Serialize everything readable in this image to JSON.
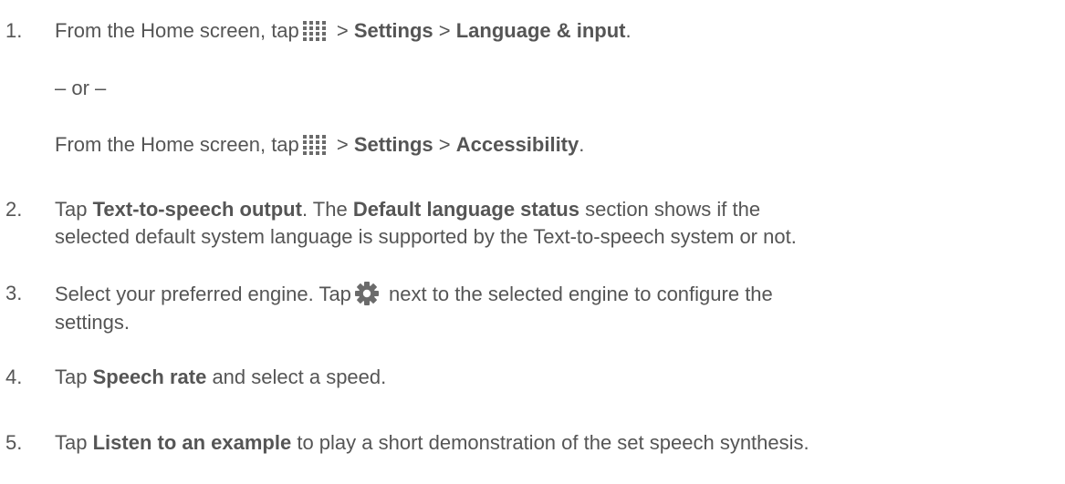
{
  "steps": [
    {
      "number": "1.",
      "line1": {
        "pre": "From the Home screen, tap",
        "sep1": " > ",
        "b1": "Settings",
        "sep2": " > ",
        "b2": "Language & input",
        "end": "."
      },
      "or": "– or –",
      "line2": {
        "pre": "From the Home screen, tap",
        "sep1": " > ",
        "b1": "Settings",
        "sep2": " > ",
        "b2": "Accessibility",
        "end": "."
      }
    },
    {
      "number": "2.",
      "pre": "Tap ",
      "b1": "Text-to-speech output",
      "mid": ". The ",
      "b2": "Default language status",
      "post": " section shows if the",
      "line2": "selected default system language is supported by the Text-to-speech system or not."
    },
    {
      "number": "3.",
      "pre": "Select your preferred engine. Tap",
      "post": " next to the selected engine to configure the",
      "line2": "settings."
    },
    {
      "number": "4.",
      "pre": "Tap ",
      "b1": "Speech rate",
      "post": " and select a speed."
    },
    {
      "number": "5.",
      "pre": "Tap ",
      "b1": "Listen to an example",
      "post": " to play a short demonstration of the set speech synthesis."
    }
  ],
  "icons": {
    "apps": "apps-grid-icon",
    "settings": "settings-gear-icon"
  },
  "colors": {
    "text": "#555555",
    "icon": "#6b6b6b"
  }
}
